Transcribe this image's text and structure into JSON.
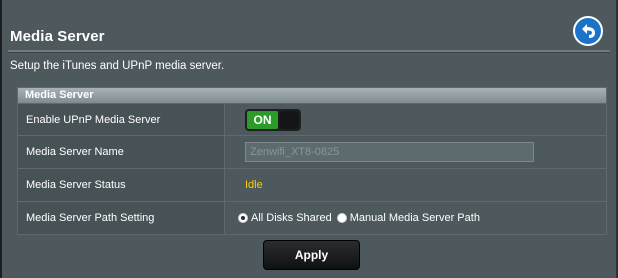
{
  "page": {
    "title": "Media Server",
    "subtitle": "Setup the iTunes and UPnP media server."
  },
  "back_button": {
    "icon": "back-arrow-icon",
    "color": "#1a73c9"
  },
  "panel": {
    "header": "Media Server",
    "rows": {
      "upnp": {
        "label": "Enable UPnP Media Server",
        "toggle_on_label": "ON",
        "enabled": true
      },
      "name": {
        "label": "Media Server Name",
        "value": "Zenwifi_XT8-0825"
      },
      "status": {
        "label": "Media Server Status",
        "value": "Idle"
      },
      "path": {
        "label": "Media Server Path Setting",
        "options": [
          {
            "label": "All Disks Shared",
            "selected": true
          },
          {
            "label": "Manual Media Server Path",
            "selected": false
          }
        ]
      }
    }
  },
  "apply_button": {
    "label": "Apply"
  },
  "colors": {
    "background": "#4d595d",
    "toggle_on": "#2c9b2a",
    "status_text": "#ffcc00"
  }
}
